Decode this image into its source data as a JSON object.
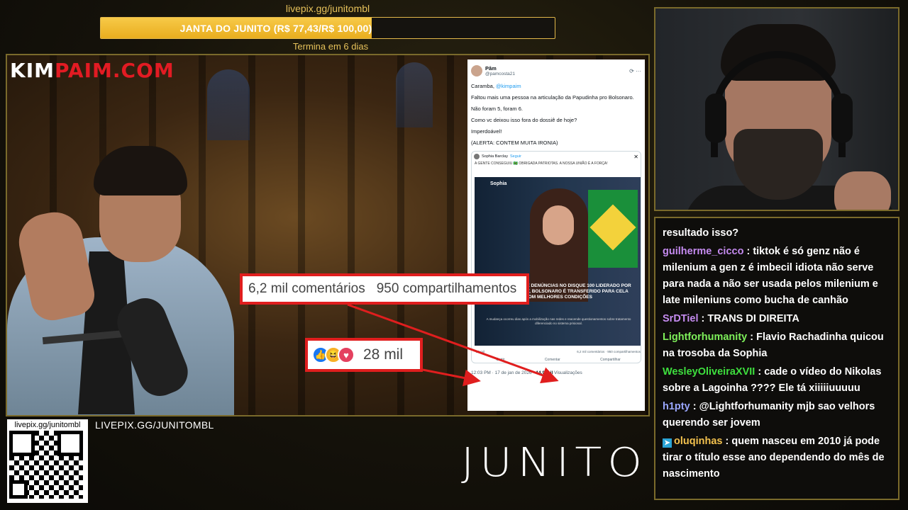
{
  "goal": {
    "url": "livepix.gg/junitombl",
    "label": "JANTA DO JUNITO (R$ 77,43/R$ 100,00)",
    "progress": 0.7743,
    "ends": "Termina em 6 dias"
  },
  "overlay": {
    "logo_white": "KIM",
    "logo_red": "PAIM.COM",
    "brand": "JUNITO",
    "qr_url": "livepix.gg/junitombl",
    "live_url": "LIVEPIX.GG/JUNITOMBL"
  },
  "tweet": {
    "name": "Pâm",
    "handle": "@pamcosta21",
    "lines": [
      "Caramba,",
      "Faltou mais uma pessoa na articulação da Papudinha pro Bolsonaro.",
      "Não foram 5, foram 6.",
      "Como vc deixou isso fora do dossiê de hoje?",
      "Imperdoável!",
      "(ALERTA: CONTEM MUITA IRONIA)"
    ],
    "mention": "@kimpaim",
    "quoted": {
      "name": "Sophia Barclay",
      "follow": "Seguir",
      "text": "A GENTE CONSEGUIU 🇧🇷 OBRIGADA PATRIOTAS. A NOSSA UNIÃO É A FORÇA!",
      "tag": "Sophia",
      "headline": "APÓS MUTIRÃO DE DENÚNCIAS NO DISQUE 100 LIDERADO POR SOPHIA BARCLAY, BOLSONARO É TRANSFERIDO PARA CELA COM MELHORES CONDIÇÕES",
      "sub": "A mudança ocorreu dias após a mobilização nas redes e reacende questionamentos sobre tratamento diferenciado no sistema prisional.",
      "reactions_small": "28 mil",
      "stats_small": "6,2 mil comentários · 950 compartilhamentos",
      "actions": [
        "Curtir",
        "Comentar",
        "Compartilhar"
      ]
    },
    "time": "12:03 PM · 17 de jan de 2026 ·",
    "views_count": "14,9 mil",
    "views_label": "Visualizações"
  },
  "callouts": {
    "comments": "6,2 mil comentários",
    "shares": "950 compartilhamentos",
    "reactions": "28 mil"
  },
  "chat": [
    {
      "user": "",
      "color": "",
      "text": "resultado isso?"
    },
    {
      "user": "guilherme_cicco",
      "color": "#c58bf0",
      "text": "tiktok é só genz não é milenium a gen z é imbecil idiota não serve para nada a não ser usada pelos milenium e late mileniuns como bucha de canhão"
    },
    {
      "user": "SrDTiel",
      "color": "#c58bf0",
      "text": "TRANS DI DIREITA"
    },
    {
      "user": "Lightforhumanity",
      "color": "#7ef05a",
      "text": "Flavio Rachadinha quicou na trosoba da Sophia"
    },
    {
      "user": "WesleyOliveiraXVII",
      "color": "#3ee03e",
      "text": "cade o vídeo do Nikolas sobre a Lagoinha ???? Ele tá xiiiiiuuuuu"
    },
    {
      "user": "h1pty",
      "color": "#9aa7ff",
      "text": "@Lightforhumanity mjb sao velhors querendo ser jovem"
    },
    {
      "user": "oluqinhas",
      "color": "#f2c14e",
      "text": "quem nasceu em 2010 já pode tirar o título esse ano dependendo do mês de nascimento",
      "badge": true
    }
  ]
}
